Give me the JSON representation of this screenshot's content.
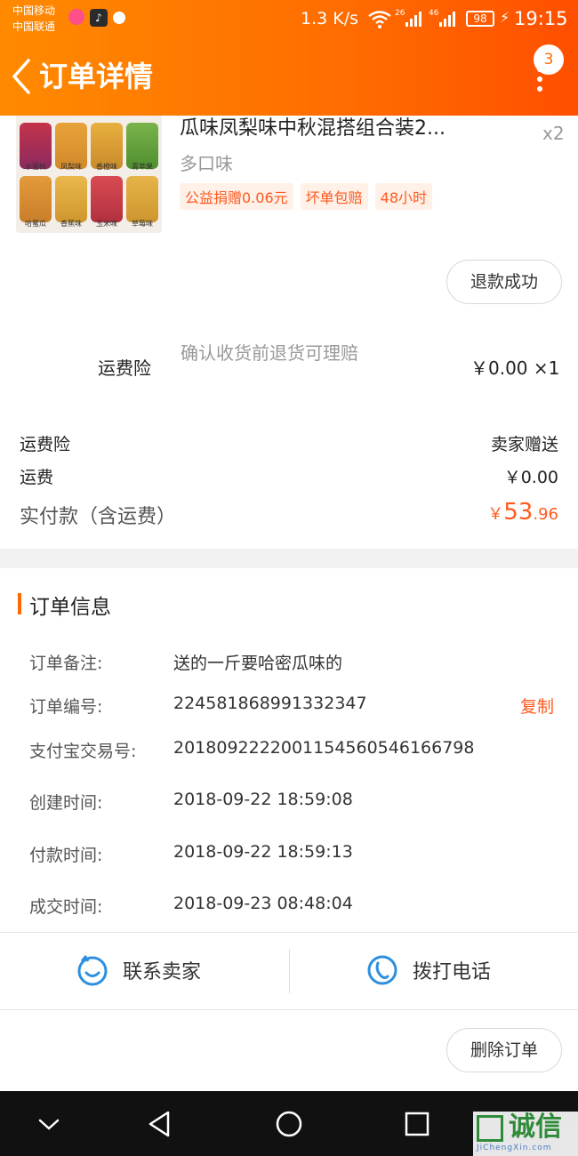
{
  "status_bar": {
    "carrier_1": "中国移动",
    "carrier_2": "中国联通",
    "net_speed": "1.3 K/s",
    "signal_1": "26",
    "signal_2": "46",
    "battery": "98",
    "time": "19:15"
  },
  "app_bar": {
    "title": "订单详情",
    "badge": "3"
  },
  "product": {
    "title": "瓜味凤梨味中秋混搭组合装2...",
    "quantity": "x2",
    "sku": "多口味",
    "tags": [
      "公益捐赠0.06元",
      "坏单包赔",
      "48小时"
    ],
    "image_labels": [
      "水蜜桃",
      "凤梨味",
      "香橙味",
      "青苹果",
      "哈蜜瓜",
      "香蕉味",
      "玉米味",
      "草莓味"
    ],
    "refund_button": "退款成功"
  },
  "insurance": {
    "label": "运费险",
    "description": "确认收货前退货可理赔",
    "price": "￥0.00 ×1"
  },
  "fees": [
    {
      "label": "运费险",
      "value": "卖家赠送"
    },
    {
      "label": "运费",
      "value": "￥0.00"
    }
  ],
  "total": {
    "label": "实付款（含运费）",
    "currency": "￥",
    "integer": "53",
    "decimal": ".96"
  },
  "order_info": {
    "title": "订单信息",
    "rows": [
      {
        "label": "订单备注:",
        "value": "送的一斤要哈密瓜味的"
      },
      {
        "label": "订单编号:",
        "value": "224581868991332347"
      },
      {
        "label": "支付宝交易号:",
        "value": "2018092222001154560546166798"
      },
      {
        "label": "创建时间:",
        "value": "2018-09-22 18:59:08"
      },
      {
        "label": "付款时间:",
        "value": "2018-09-22 18:59:13"
      },
      {
        "label": "成交时间:",
        "value": "2018-09-23 08:48:04"
      }
    ],
    "copy_label": "复制"
  },
  "actions": {
    "contact_seller": "联系卖家",
    "call_phone": "拨打电话",
    "delete_order": "删除订单"
  },
  "watermark": {
    "text": "诚信",
    "sub": "JiChengXin.com"
  },
  "colors": {
    "accent": "#ff6a00",
    "price": "#ff5a1f",
    "icon_blue": "#2d8fe0"
  }
}
